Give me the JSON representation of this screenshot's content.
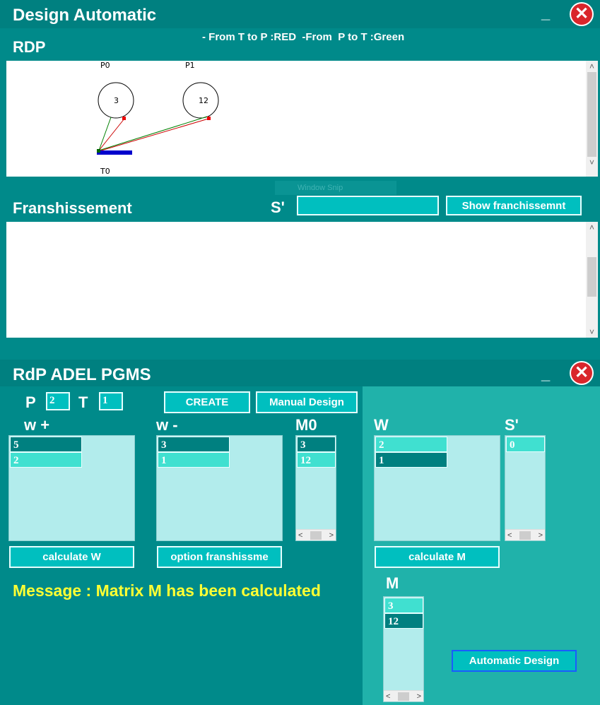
{
  "window1": {
    "title": "Design Automatic",
    "legend": "- From T to P :RED  -From  P to T :Green",
    "rdp_label": "RDP",
    "minimize": "_",
    "close": "✕"
  },
  "petri": {
    "places": [
      {
        "name": "P0",
        "tokens": "3"
      },
      {
        "name": "P1",
        "tokens": "12"
      }
    ],
    "transition": "T0",
    "arc_colors": {
      "t_to_p": "#cc0000",
      "p_to_t": "#008000",
      "transition_bar": "#0000cc"
    }
  },
  "ghost_text": "Window Snip",
  "franchise": {
    "label": "Franshissement",
    "s_label": "S'",
    "s_value": "",
    "show_button": "Show franchissemnt"
  },
  "window2": {
    "title": "RdP ADEL PGMS",
    "minimize": "_",
    "close": "✕",
    "p_label": "P",
    "p_value": "2",
    "t_label": "T",
    "t_value": "1",
    "create_button": "CREATE",
    "manual_button": "Manual Design",
    "w_plus_label": "w +",
    "w_minus_label": "w -",
    "m0_label": "M0",
    "w_label": "W",
    "s_label": "S'",
    "m_label": "M",
    "w_plus_items": [
      "5",
      "2"
    ],
    "w_minus_items": [
      "3",
      "1"
    ],
    "m0_items": [
      "3",
      "12"
    ],
    "w_items": [
      "2",
      "1"
    ],
    "s_items": [
      "0"
    ],
    "m_items": [
      "3",
      "12"
    ],
    "calc_w_button": "calculate W",
    "option_button": "option franshissme",
    "calc_m_button": "calculate M",
    "auto_button": "Automatic Design",
    "message": "Message : Matrix M has been calculated"
  },
  "colors": {
    "teal": "#008a8a",
    "right_panel": "#20b2aa",
    "message": "#ffff33"
  }
}
